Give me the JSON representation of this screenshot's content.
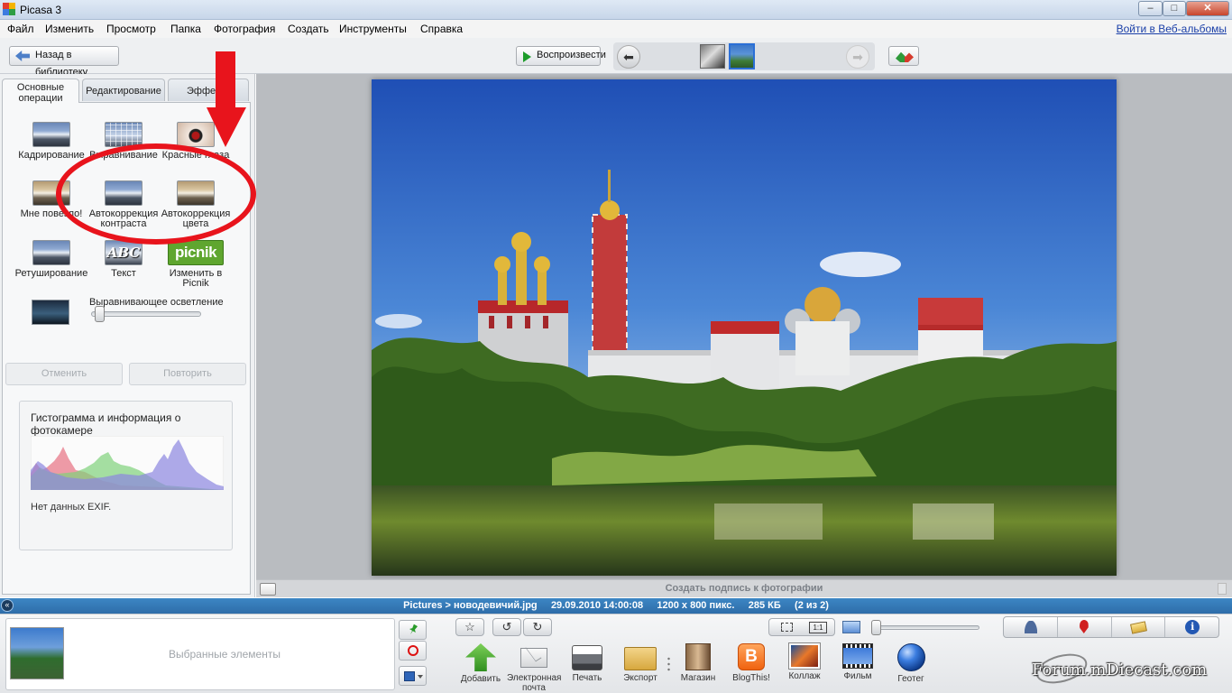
{
  "app": {
    "title": "Picasa 3"
  },
  "window_controls": {
    "minimize": "–",
    "maximize": "□",
    "close": "✕"
  },
  "menu": {
    "items": [
      "Файл",
      "Изменить",
      "Просмотр",
      "Папка",
      "Фотография",
      "Создать",
      "Инструменты",
      "Справка"
    ],
    "web_albums_link": "Войти в Веб-альбомы"
  },
  "toolbar": {
    "back_label": "Назад в библиотеку",
    "play_label": "Воспроизвести",
    "prev": "⬅",
    "next": "➡"
  },
  "tabs": [
    "Основные операции",
    "Редактирование",
    "Эффекты"
  ],
  "tools": [
    {
      "label": "Кадрирование"
    },
    {
      "label": "Выравнивание"
    },
    {
      "label": "Красные глаза"
    },
    {
      "label": "Мне повезло!"
    },
    {
      "label": "Автокоррекция контраста"
    },
    {
      "label": "Автокоррекция цвета"
    },
    {
      "label": "Ретуширование"
    },
    {
      "label": "Текст",
      "icon_text": "ABC"
    },
    {
      "label": "Изменить в Picnik",
      "icon_text": "picnik"
    }
  ],
  "fill_light": {
    "label": "Выравнивающее осветление",
    "value": 0
  },
  "history": {
    "undo": "Отменить",
    "redo": "Повторить"
  },
  "histogram": {
    "title": "Гистограмма и информация о фотокамере",
    "exif": "Нет данных EXIF."
  },
  "caption": {
    "placeholder": "Создать подпись к фотографии"
  },
  "status": {
    "path": "Pictures > новодевичий.jpg",
    "date": "29.09.2010 14:00:08",
    "dimensions": "1200 x 800 пикс.",
    "size": "285 КБ",
    "position": "(2 из 2)"
  },
  "tray": {
    "label": "Выбранные элементы",
    "actions": [
      {
        "label": "Добавить"
      },
      {
        "label": "Электронная почта"
      },
      {
        "label": "Печать"
      },
      {
        "label": "Экспорт"
      },
      {
        "label": "Магазин"
      },
      {
        "label": "BlogThis!",
        "icon_text": "B"
      },
      {
        "label": "Коллаж"
      },
      {
        "label": "Фильм"
      },
      {
        "label": "Геотег"
      }
    ],
    "zoom_actual": "1:1"
  },
  "info_icon": "i",
  "watermark": "Forum.mDiecast.com",
  "colors": {
    "accent": "#2e6da9",
    "annotation": "#e8141c",
    "statusbar": "#3c86c4"
  }
}
